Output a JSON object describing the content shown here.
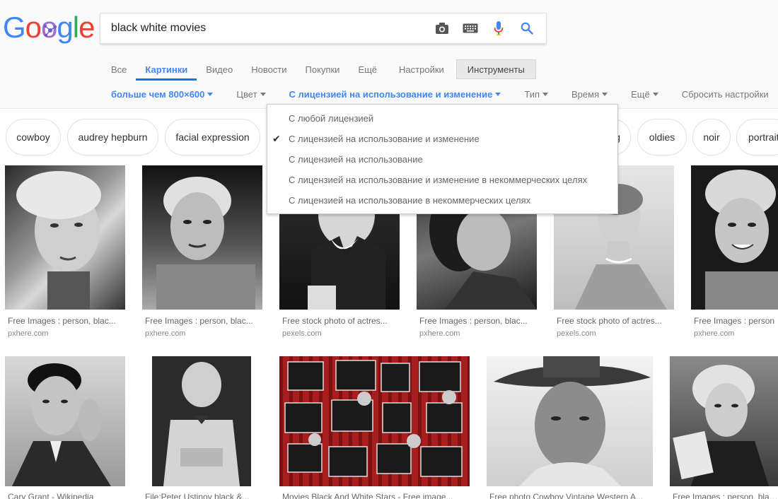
{
  "search": {
    "query": "black white movies"
  },
  "tabs": [
    {
      "label": "Все"
    },
    {
      "label": "Картинки"
    },
    {
      "label": "Видео"
    },
    {
      "label": "Новости"
    },
    {
      "label": "Покупки"
    },
    {
      "label": "Ещё"
    },
    {
      "label": "Настройки"
    },
    {
      "label": "Инструменты"
    }
  ],
  "filters": {
    "size": "больше чем 800×600",
    "color": "Цвет",
    "license": "С лицензией на использование и изменение",
    "type": "Тип",
    "time": "Время",
    "more": "Ещё",
    "reset": "Сбросить настройки"
  },
  "license_dropdown": {
    "options": [
      {
        "label": "С любой лицензией",
        "checked": false
      },
      {
        "label": "С лицензией на использование и изменение",
        "checked": true
      },
      {
        "label": "С лицензией на использование",
        "checked": false
      },
      {
        "label": "С лицензией на использование и изменение в некоммерческих целях",
        "checked": false
      },
      {
        "label": "С лицензией на использование в некоммерческих целях",
        "checked": false
      }
    ]
  },
  "chips": [
    {
      "label": "cowboy"
    },
    {
      "label": "audrey hepburn"
    },
    {
      "label": "facial expression"
    },
    {
      "label": "g"
    },
    {
      "label": "oldies"
    },
    {
      "label": "noir"
    },
    {
      "label": "portrait"
    }
  ],
  "results_row1": [
    {
      "caption": "Free Images : person, blac...",
      "domain": "pxhere.com"
    },
    {
      "caption": "Free Images : person, blac...",
      "domain": "pxhere.com"
    },
    {
      "caption": "Free stock photo of actres...",
      "domain": "pexels.com"
    },
    {
      "caption": "Free Images : person, blac...",
      "domain": "pxhere.com"
    },
    {
      "caption": "Free stock photo of actres...",
      "domain": "pexels.com"
    },
    {
      "caption": "Free Images : person",
      "domain": "pxhere.com"
    }
  ],
  "results_row2": [
    {
      "caption": "Cary Grant - Wikipedia"
    },
    {
      "caption": "File:Peter Ustinov black &..."
    },
    {
      "caption": "Movies Black And White Stars - Free image..."
    },
    {
      "caption": "Free photo Cowboy Vintage Western A..."
    },
    {
      "caption": "Free Images : person, blac..."
    }
  ],
  "colors": {
    "accent": "#4285f4",
    "logo_blue": "#4285f4",
    "logo_red": "#ea4335",
    "logo_yellow": "#fbbc05",
    "logo_green": "#34a853",
    "reel_red": "#a81d1d"
  }
}
